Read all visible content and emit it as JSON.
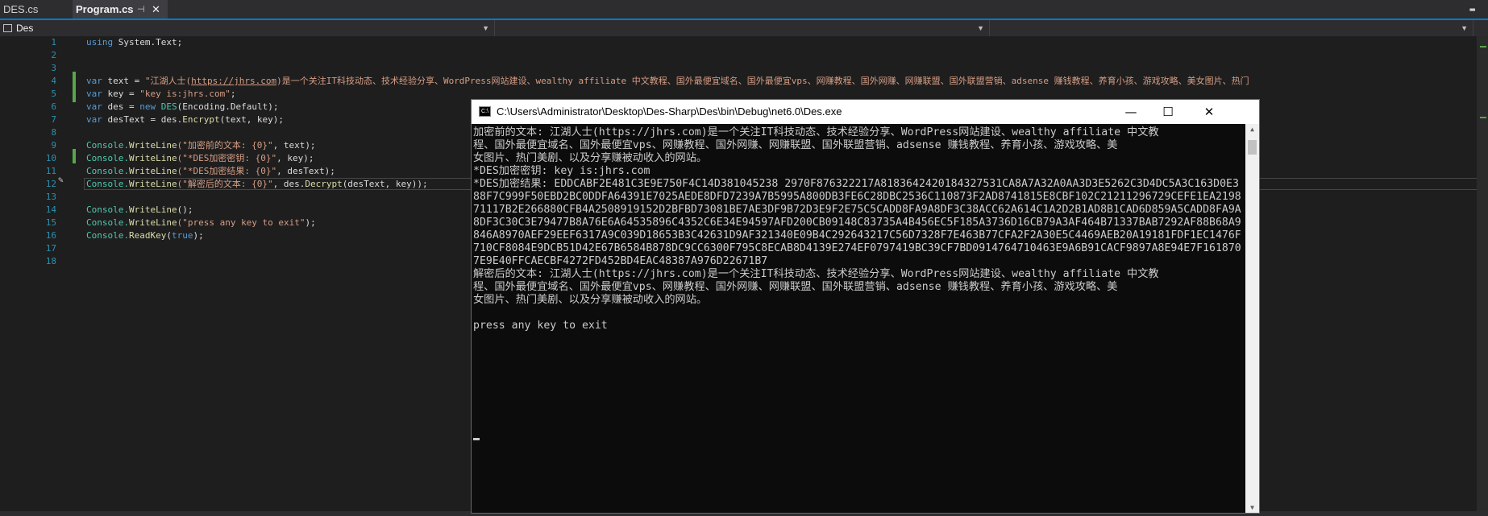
{
  "tabs": [
    {
      "label": "DES.cs",
      "active": false
    },
    {
      "label": "Program.cs",
      "active": true,
      "pin_icon": "pin-icon",
      "close_icon": "close-icon"
    }
  ],
  "navbar": {
    "project": "Des",
    "member": "",
    "extra": ""
  },
  "line_numbers": [
    "1",
    "2",
    "3",
    "4",
    "5",
    "6",
    "7",
    "8",
    "9",
    "10",
    "11",
    "12",
    "13",
    "14",
    "15",
    "16",
    "17",
    "18"
  ],
  "code": {
    "l1_kw": "using",
    "l1_rest": " System.Text;",
    "l4_kw": "var",
    "l4_a": " text = ",
    "l4_s1": "\"江湖人士(",
    "l4_link": "https://jhrs.com",
    "l4_s2": ")是一个关注IT科技动态、技术经验分享、WordPress网站建设、wealthy affiliate 中文教程、国外最便宜域名、国外最便宜vps、网赚教程、国外网赚、网赚联盟、国外联盟营销、adsense 赚钱教程、养育小孩、游戏攻略、美女图片、热门",
    "l5_kw": "var",
    "l5_a": " key = ",
    "l5_s": "\"key is:jhrs.com\"",
    "l5_b": ";",
    "l6_kw": "var",
    "l6_a": " des = ",
    "l6_new": "new",
    "l6_typ": " DES",
    "l6_b": "(Encoding.Default);",
    "l7_kw": "var",
    "l7_a": " desText = des.",
    "l7_fn": "Encrypt",
    "l7_b": "(text, key);",
    "l9_a": "Console.",
    "l9_fn": "WriteLine",
    "l9_s": "(\"加密前的文本: {0}\"",
    "l9_b": ", text);",
    "l10_a": "Console.",
    "l10_fn": "WriteLine",
    "l10_s": "(\"*DES加密密钥: {0}\"",
    "l10_b": ", key);",
    "l11_a": "Console.",
    "l11_fn": "WriteLine",
    "l11_s": "(\"*DES加密结果: {0}\"",
    "l11_b": ", desText);",
    "l12_a": "Console.",
    "l12_fn": "WriteLine",
    "l12_s": "(\"解密后的文本: {0}\"",
    "l12_b": ", des.",
    "l12_fn2": "Decrypt",
    "l12_c": "(desText, key));",
    "l14_a": "Console.",
    "l14_fn": "WriteLine",
    "l14_b": "();",
    "l15_a": "Console.",
    "l15_fn": "WriteLine",
    "l15_s": "(\"press any key to exit\"",
    "l15_b": ");",
    "l16_a": "Console.",
    "l16_fn": "ReadKey",
    "l16_b": "(",
    "l16_kw": "true",
    "l16_c": ");"
  },
  "console": {
    "title": "C:\\Users\\Administrator\\Desktop\\Des-Sharp\\Des\\bin\\Debug\\net6.0\\Des.exe",
    "icon_text": "C:\\",
    "min": "—",
    "max": "☐",
    "close": "✕",
    "lines": [
      "加密前的文本: 江湖人士(https://jhrs.com)是一个关注IT科技动态、技术经验分享、WordPress网站建设、wealthy affiliate 中文教",
      "程、国外最便宜域名、国外最便宜vps、网赚教程、国外网赚、网赚联盟、国外联盟营销、adsense 赚钱教程、养育小孩、游戏攻略、美",
      "女图片、热门美剧、以及分享赚被动收入的网站。",
      "*DES加密密钥: key is:jhrs.com",
      "*DES加密结果: EDDCABF2E481C3E9E750F4C14D381045238 2970F876322217A8183642420184327531CA8A7A32A0AA3D3E5262C3D4DC5A3C163D0E3",
      "88F7C999F50EBD2BC0DDFA64391E7025AEDE8DFD7239A7B5995A800DB3FE6C28DBC2536C110873F2AD8741815E8CBF102C21211296729CEFE1EA2198",
      "71117B2E266880CFB4A2508919152D2BFBD73081BE7AE3DF9B72D3E9F2E75C5CADD8FA9A8DF3C38ACC62A614C1A2D2B1AD8B1CAD6D859A5CADD8FA9A",
      "8DF3C30C3E79477B8A76E6A64535896C4352C6E34E94597AFD200CB09148C83735A4B456EC5F185A3736D16CB79A3AF464B71337BAB7292AF88B68A9",
      "846A8970AEF29EEF6317A9C039D18653B3C42631D9AF321340E09B4C292643217C56D7328F7E463B77CFA2F2A30E5C4469AEB20A19181FDF1EC1476F",
      "710CF8084E9DCB51D42E67B6584B878DC9CC6300F795C8ECAB8D4139E274EF0797419BC39CF7BD0914764710463E9A6B91CACF9897A8E94E7F161870",
      "7E9E40FFCAECBF4272FD452BD4EAC48387A976D22671B7",
      "解密后的文本: 江湖人士(https://jhrs.com)是一个关注IT科技动态、技术经验分享、WordPress网站建设、wealthy affiliate 中文教",
      "程、国外最便宜域名、国外最便宜vps、网赚教程、国外网赚、网赚联盟、国外联盟营销、adsense 赚钱教程、养育小孩、游戏攻略、美",
      "女图片、热门美剧、以及分享赚被动收入的网站。",
      "",
      "press any key to exit"
    ]
  },
  "colors": {
    "editor_bg": "#1e1e1e",
    "accent": "#007acc",
    "change_bar": "#57a64a",
    "keyword": "#569cd6",
    "string": "#d69d85"
  },
  "icons": {
    "nav_icon": "namespace-icon",
    "edit_hint": "screwdriver-icon"
  }
}
